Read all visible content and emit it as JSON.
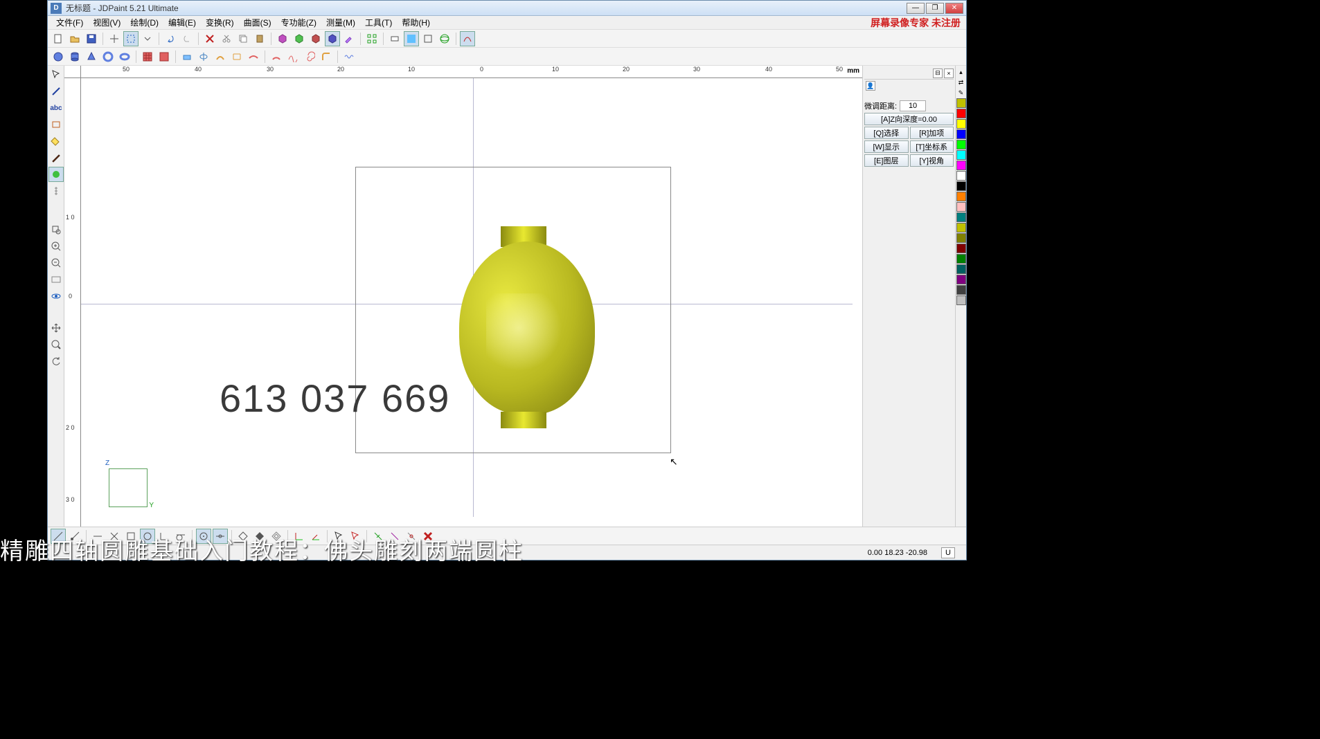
{
  "titlebar": {
    "app_icon_letter": "D",
    "text": "无标题 - JDPaint 5.21 Ultimate"
  },
  "window_controls": {
    "min": "—",
    "max": "❐",
    "close": "✕"
  },
  "menubar": {
    "items": [
      "文件(F)",
      "视图(V)",
      "绘制(D)",
      "编辑(E)",
      "变换(R)",
      "曲面(S)",
      "专功能(Z)",
      "测量(M)",
      "工具(T)",
      "帮助(H)"
    ],
    "recorder_watermark": "屏幕录像专家 未注册"
  },
  "ruler": {
    "unit": "mm",
    "h_ticks": [
      "50",
      "40",
      "30",
      "20",
      "10",
      "0",
      "10",
      "20",
      "30",
      "40",
      "50"
    ],
    "v_ticks": [
      "0",
      "1 0",
      "2 0",
      "3 0"
    ]
  },
  "canvas": {
    "watermark_number": "613 037 669",
    "axis_z": "Z",
    "axis_y": "Y"
  },
  "right_panel": {
    "finetune_label": "微调距离:",
    "finetune_value": "10",
    "depth_btn": "[A]Z向深度=0.00",
    "buttons": [
      [
        "[Q]选择",
        "[R]加项"
      ],
      [
        "[W]显示",
        "[T]坐标系"
      ],
      [
        "[E]图层",
        "[Y]视角"
      ]
    ]
  },
  "colors": [
    "#ff0000",
    "#ffff00",
    "#0000ff",
    "#00ff00",
    "#00ffff",
    "#ff00ff",
    "#ffffff",
    "#000000",
    "#ff8000",
    "#ffc0c0",
    "#008080",
    "#c0c000",
    "#808000",
    "#800000",
    "#008000",
    "#006060",
    "#800080",
    "#404040",
    "#c0c0c0"
  ],
  "statusbar": {
    "coords": "0.00 18.23 -20.98",
    "u_btn": "U"
  },
  "video_caption": "精雕四轴圆雕基础入门教程：佛头雕刻两端圆柱"
}
